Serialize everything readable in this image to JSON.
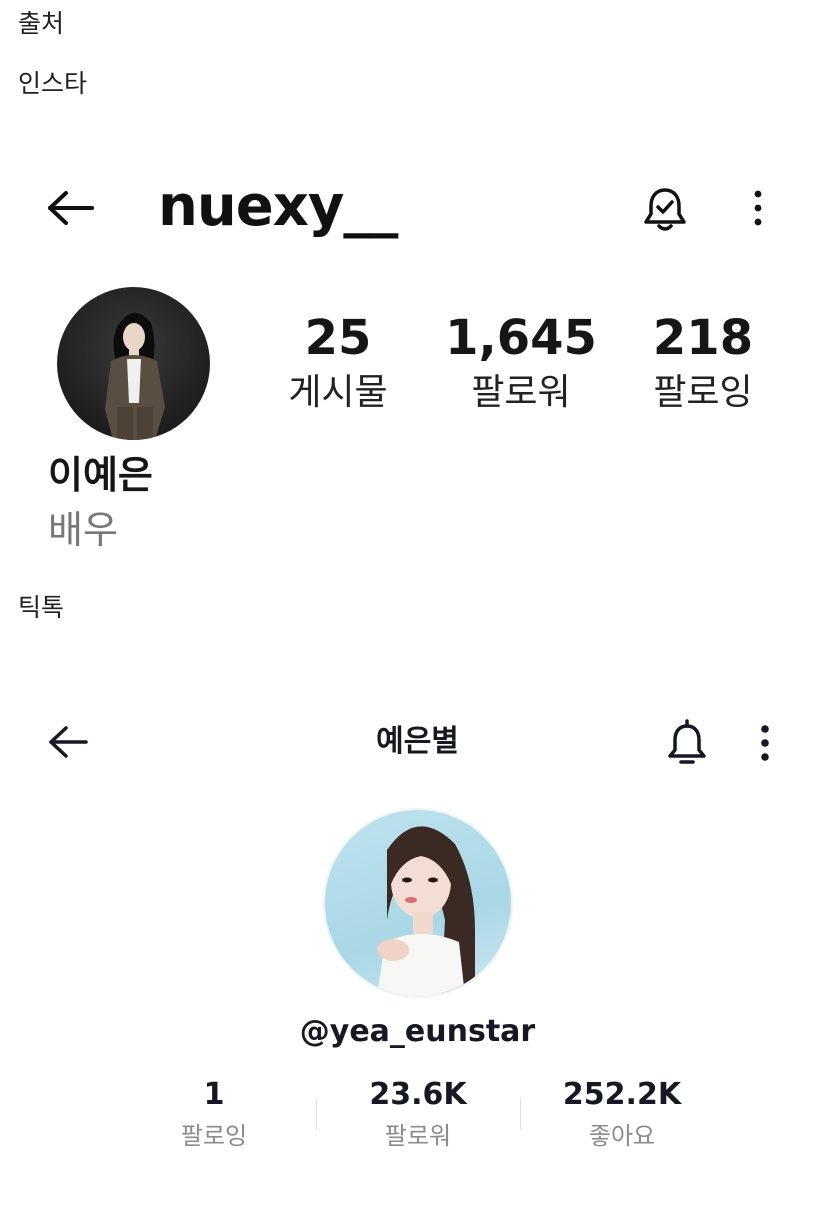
{
  "captions": {
    "source": "출처",
    "instagram": "인스타",
    "tiktok": "틱톡"
  },
  "instagram": {
    "username": "nuexy__",
    "stats": [
      {
        "value": "25",
        "label": "게시물"
      },
      {
        "value": "1,645",
        "label": "팔로워"
      },
      {
        "value": "218",
        "label": "팔로잉"
      }
    ],
    "name": "이예은",
    "bio": "배우",
    "icons": [
      "back-arrow-icon",
      "notification-bell-check-icon",
      "more-vertical-icon"
    ]
  },
  "tiktok": {
    "title": "예은별",
    "handle": "@yea_eunstar",
    "stats": [
      {
        "value": "1",
        "label": "팔로잉"
      },
      {
        "value": "23.6K",
        "label": "팔로워"
      },
      {
        "value": "252.2K",
        "label": "좋아요"
      }
    ],
    "icons": [
      "back-arrow-icon",
      "notification-bell-icon",
      "more-vertical-icon"
    ]
  }
}
